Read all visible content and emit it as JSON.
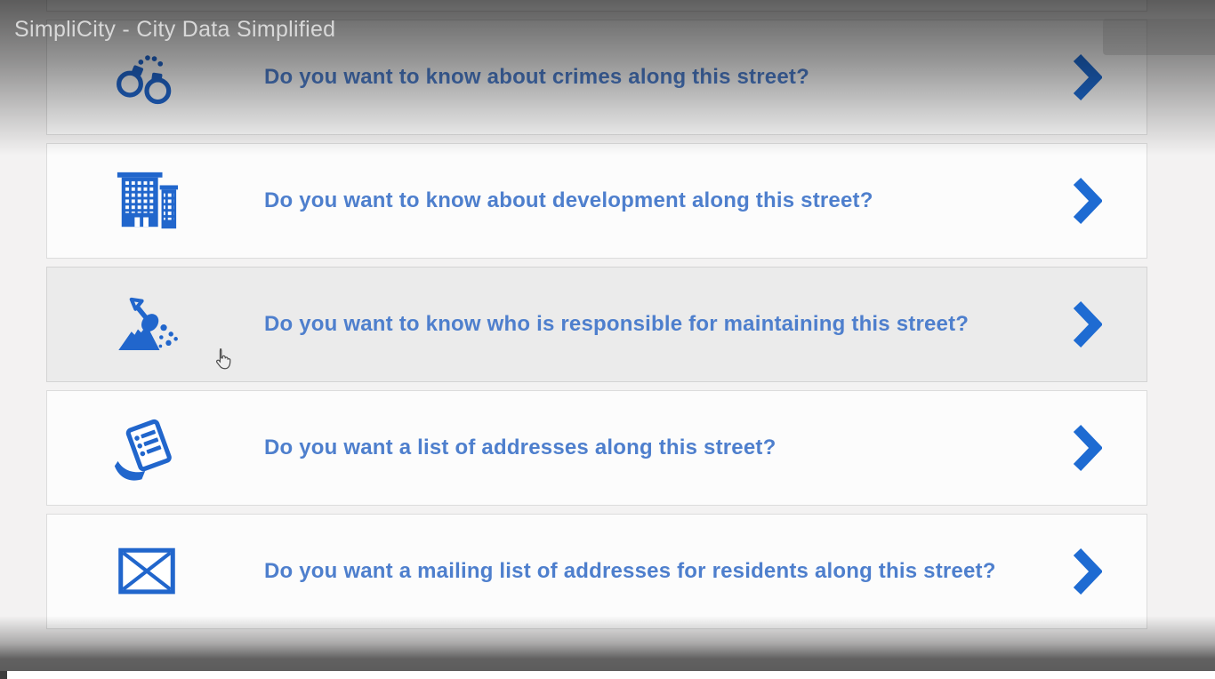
{
  "video_overlay": {
    "title": "SimpliCity - City Data Simplified"
  },
  "cards": [
    {
      "icon": "handcuffs-icon",
      "question": "Do you want to know about crimes along this street?"
    },
    {
      "icon": "building-icon",
      "question": "Do you want to know about development along this street?"
    },
    {
      "icon": "shovel-icon",
      "question": "Do you want to know who is responsible for maintaining this street?",
      "state": "hovered"
    },
    {
      "icon": "list-icon",
      "question": "Do you want a list of addresses along this street?"
    },
    {
      "icon": "envelope-icon",
      "question": "Do you want a mailing list of addresses for residents along this street?"
    }
  ],
  "colors": {
    "accent_blue": "#2166cc",
    "chevron_blue": "#1e6bd2",
    "question_blue": "#4e7fcd",
    "page_bg": "#f3f2f2",
    "card_bg": "#fcfcfc",
    "hover_bg": "#ebebeb",
    "title_gray": "#d8d8d8"
  }
}
